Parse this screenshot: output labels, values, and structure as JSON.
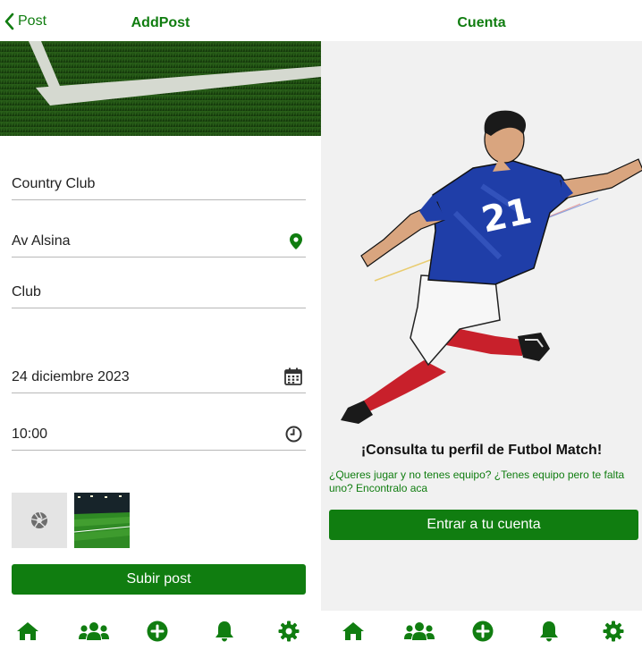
{
  "colors": {
    "accent": "#107d10",
    "field_line": "#b8b8b8",
    "bg_right": "#f1f1f1"
  },
  "add_post": {
    "back_label": "Post",
    "title": "AddPost",
    "fields": {
      "name": "Country Club",
      "address": "Av Alsina",
      "type": "Club",
      "date": "24 diciembre 2023",
      "time": "10:00"
    },
    "icons": {
      "address": "map-pin-icon",
      "date": "calendar-icon",
      "time": "clock-icon",
      "photo": "camera-shutter-icon"
    },
    "submit_label": "Subir post"
  },
  "account": {
    "title": "Cuenta",
    "heading": "¡Consulta tu perfil de Futbol Match!",
    "subtext": "¿Queres jugar y no tenes equipo? ¿Tenes equipo pero te falta uno? Encontralo aca",
    "button_label": "Entrar a tu cuenta",
    "jersey_number": "21"
  },
  "tabbar": {
    "items": [
      "home-icon",
      "users-icon",
      "plus-circle-icon",
      "bell-icon",
      "gear-icon"
    ]
  }
}
